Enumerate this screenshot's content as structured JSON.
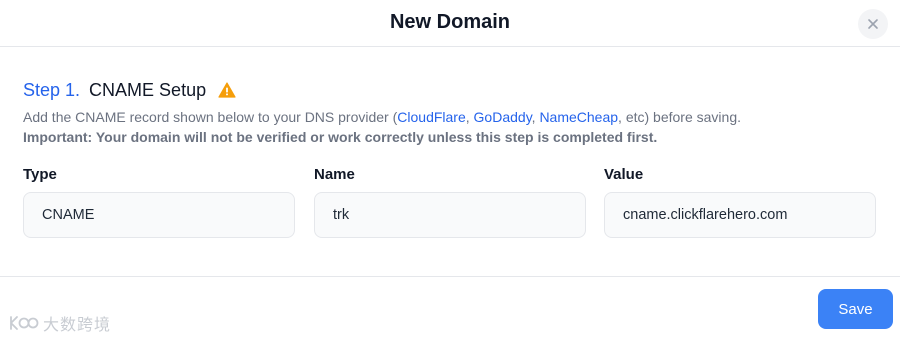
{
  "modal": {
    "title": "New Domain"
  },
  "step": {
    "number": "Step 1.",
    "title": "CNAME Setup",
    "description_prefix": "Add the CNAME record shown below to your DNS provider (",
    "providers": [
      "CloudFlare",
      "GoDaddy",
      "NameCheap"
    ],
    "description_suffix": ", etc) before saving.",
    "important": "Important: Your domain will not be verified or work correctly unless this step is completed first."
  },
  "fields": [
    {
      "label": "Type",
      "value": "CNAME"
    },
    {
      "label": "Name",
      "value": "trk"
    },
    {
      "label": "Value",
      "value": "cname.clickflarehero.com"
    }
  ],
  "footer": {
    "save_label": "Save"
  },
  "watermark": {
    "text": "大数跨境"
  },
  "colors": {
    "accent": "#3b82f6",
    "link": "#2563eb",
    "warning": "#f59e0b"
  },
  "icons": {
    "close": "close-icon",
    "warning": "warning-icon"
  }
}
